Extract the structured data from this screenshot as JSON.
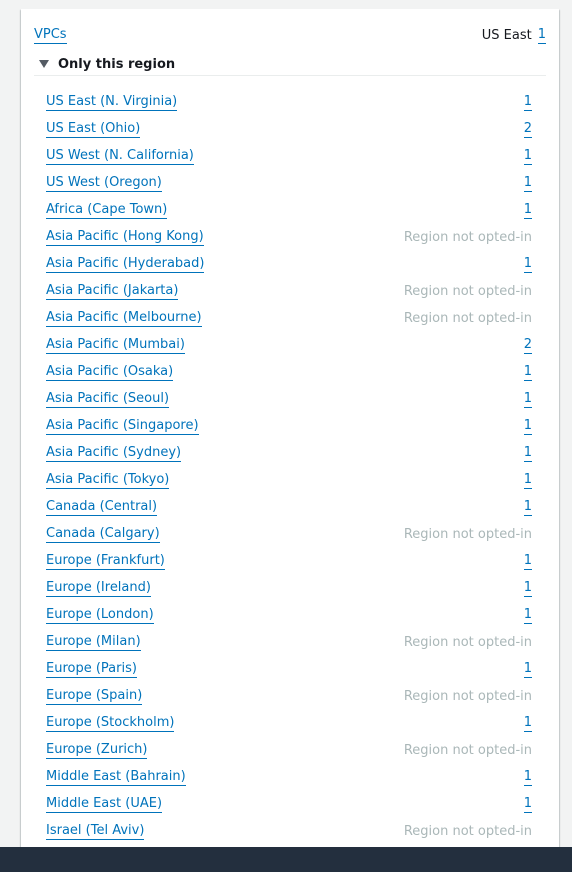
{
  "header": {
    "title_link": "VPCs",
    "region_label": "US East",
    "region_count": "1"
  },
  "expander": {
    "label": "Only this region"
  },
  "regions": [
    {
      "name": "US East (N. Virginia)",
      "value": "1"
    },
    {
      "name": "US East (Ohio)",
      "value": "2"
    },
    {
      "name": "US West (N. California)",
      "value": "1"
    },
    {
      "name": "US West (Oregon)",
      "value": "1"
    },
    {
      "name": "Africa (Cape Town)",
      "value": "1"
    },
    {
      "name": "Asia Pacific (Hong Kong)",
      "value": "Region not opted-in"
    },
    {
      "name": "Asia Pacific (Hyderabad)",
      "value": "1"
    },
    {
      "name": "Asia Pacific (Jakarta)",
      "value": "Region not opted-in"
    },
    {
      "name": "Asia Pacific (Melbourne)",
      "value": "Region not opted-in"
    },
    {
      "name": "Asia Pacific (Mumbai)",
      "value": "2"
    },
    {
      "name": "Asia Pacific (Osaka)",
      "value": "1"
    },
    {
      "name": "Asia Pacific (Seoul)",
      "value": "1"
    },
    {
      "name": "Asia Pacific (Singapore)",
      "value": "1"
    },
    {
      "name": "Asia Pacific (Sydney)",
      "value": "1"
    },
    {
      "name": "Asia Pacific (Tokyo)",
      "value": "1"
    },
    {
      "name": "Canada (Central)",
      "value": "1"
    },
    {
      "name": "Canada (Calgary)",
      "value": "Region not opted-in"
    },
    {
      "name": "Europe (Frankfurt)",
      "value": "1"
    },
    {
      "name": "Europe (Ireland)",
      "value": "1"
    },
    {
      "name": "Europe (London)",
      "value": "1"
    },
    {
      "name": "Europe (Milan)",
      "value": "Region not opted-in"
    },
    {
      "name": "Europe (Paris)",
      "value": "1"
    },
    {
      "name": "Europe (Spain)",
      "value": "Region not opted-in"
    },
    {
      "name": "Europe (Stockholm)",
      "value": "1"
    },
    {
      "name": "Europe (Zurich)",
      "value": "Region not opted-in"
    },
    {
      "name": "Middle East (Bahrain)",
      "value": "1"
    },
    {
      "name": "Middle East (UAE)",
      "value": "1"
    },
    {
      "name": "Israel (Tel Aviv)",
      "value": "Region not opted-in"
    }
  ],
  "colors": {
    "link": "#0073bb",
    "muted": "#aab7b8",
    "text": "#16191f",
    "footer": "#232f3e"
  }
}
